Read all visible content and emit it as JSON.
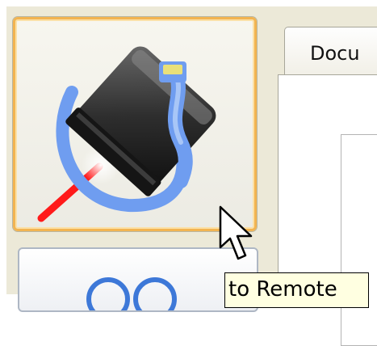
{
  "tabs": {
    "document_label": "Docu"
  },
  "toolbar": {
    "connect_icon_name": "usb-device-cable-icon",
    "second_icon_name": "two-circles-icon"
  },
  "tooltip": {
    "text": "to Remote"
  },
  "colors": {
    "button_highlight_border": "#f2b451",
    "tooltip_background": "#ffffe1",
    "cable_blue": "#6f9df0",
    "laser_red": "#ff1a1a",
    "window_background": "#ece9d8"
  }
}
